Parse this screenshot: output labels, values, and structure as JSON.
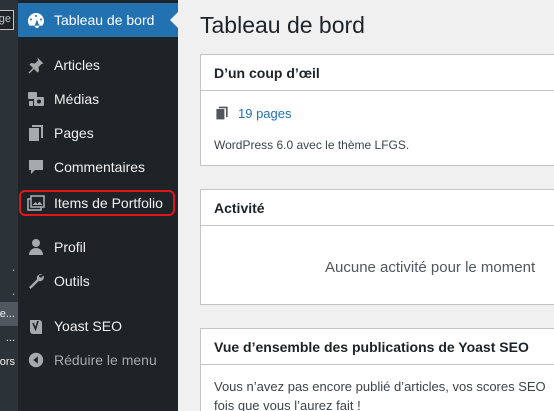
{
  "left_strip": {
    "top_label": "ge",
    "items": [
      ".",
      ".",
      "e...",
      "...",
      "ors"
    ]
  },
  "menu": {
    "items": [
      {
        "label": "Tableau de bord",
        "icon": "dashboard-icon"
      },
      {
        "label": "Articles",
        "icon": "pin-icon"
      },
      {
        "label": "Médias",
        "icon": "media-icon"
      },
      {
        "label": "Pages",
        "icon": "pages-icon"
      },
      {
        "label": "Commentaires",
        "icon": "comment-icon"
      },
      {
        "label": "Items de Portfolio",
        "icon": "portfolio-icon"
      },
      {
        "label": "Profil",
        "icon": "user-icon"
      },
      {
        "label": "Outils",
        "icon": "wrench-icon"
      },
      {
        "label": "Yoast SEO",
        "icon": "yoast-icon"
      },
      {
        "label": "Réduire le menu",
        "icon": "collapse-icon"
      }
    ]
  },
  "main": {
    "title": "Tableau de bord",
    "glance": {
      "title": "D’un coup d’œil",
      "pages_link": "19 pages",
      "info": "WordPress 6.0 avec le thème LFGS."
    },
    "activity": {
      "title": "Activité",
      "empty": "Aucune activité pour le moment"
    },
    "yoast": {
      "title": "Vue d’ensemble des publications de Yoast SEO",
      "line1": "Vous n’avez pas encore publié d’articles, vos scores SEO",
      "line2": "fois que vous l’aurez fait !"
    }
  },
  "colors": {
    "menu_bg": "#1d2327",
    "active_bg": "#2271b1",
    "link": "#2271b1",
    "highlight_border": "#e0161b"
  }
}
